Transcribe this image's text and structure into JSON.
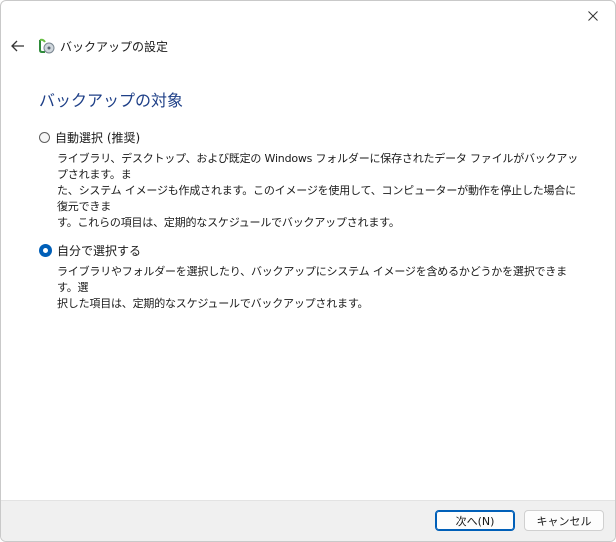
{
  "window": {
    "title": "バックアップの設定",
    "close_icon": "close-icon"
  },
  "page": {
    "title": "バックアップの対象"
  },
  "options": [
    {
      "label": "自動選択 (推奨)",
      "checked": false,
      "desc_lines": [
        "ライブラリ、デスクトップ、および既定の Windows フォルダーに保存されたデータ ファイルがバックアップされます。ま",
        "た、システム イメージも作成されます。このイメージを使用して、コンピューターが動作を停止した場合に復元できま",
        "す。これらの項目は、定期的なスケジュールでバックアップされます。"
      ]
    },
    {
      "label": "自分で選択する",
      "checked": true,
      "desc_lines": [
        "ライブラリやフォルダーを選択したり、バックアップにシステム イメージを含めるかどうかを選択できます。選",
        "択した項目は、定期的なスケジュールでバックアップされます。"
      ]
    }
  ],
  "footer": {
    "next_label": "次へ(N)",
    "cancel_label": "キャンセル"
  },
  "colors": {
    "accent": "#005fb8",
    "title": "#1e3f87",
    "footer_bg": "#f0f0f0"
  }
}
